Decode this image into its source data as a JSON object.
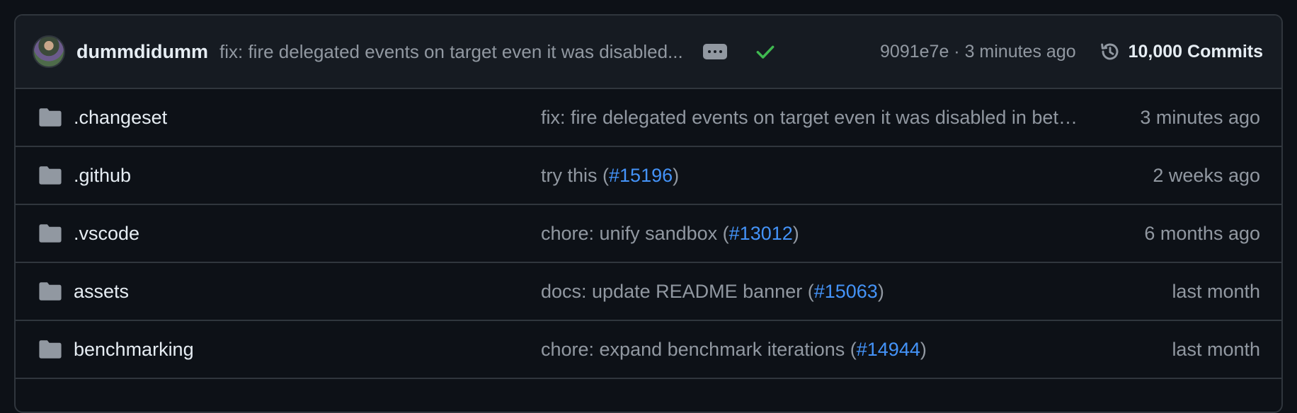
{
  "commit_bar": {
    "author": "dummdidumm",
    "message": "fix: fire delegated events on target even it was disabled...",
    "sha": "9091e7e",
    "separator": " · ",
    "time": "3 minutes ago",
    "commits_label": "10,000 Commits",
    "check_icon": "check-icon",
    "history_icon": "history-icon",
    "status_color": "#3fb950"
  },
  "files": [
    {
      "name": ".changeset",
      "icon": "folder-icon",
      "message": "fix: fire delegated events on target even it was disabled in between",
      "message_prefix": "",
      "pr": "",
      "message_suffix": "",
      "time": "3 minutes ago"
    },
    {
      "name": ".github",
      "icon": "folder-icon",
      "message": "",
      "message_prefix": "try this (",
      "pr": "#15196",
      "message_suffix": ")",
      "time": "2 weeks ago"
    },
    {
      "name": ".vscode",
      "icon": "folder-icon",
      "message": "",
      "message_prefix": "chore: unify sandbox (",
      "pr": "#13012",
      "message_suffix": ")",
      "time": "6 months ago"
    },
    {
      "name": "assets",
      "icon": "folder-icon",
      "message": "",
      "message_prefix": "docs: update README banner (",
      "pr": "#15063",
      "message_suffix": ")",
      "time": "last month"
    },
    {
      "name": "benchmarking",
      "icon": "folder-icon",
      "message": "",
      "message_prefix": "chore: expand benchmark iterations (",
      "pr": "#14944",
      "message_suffix": ")",
      "time": "last month"
    }
  ],
  "colors": {
    "background": "#0d1117",
    "header_background": "#161b22",
    "border": "#30363d",
    "link": "#4493f8",
    "muted_text": "#9198a1",
    "primary_text": "#e6edf3"
  }
}
